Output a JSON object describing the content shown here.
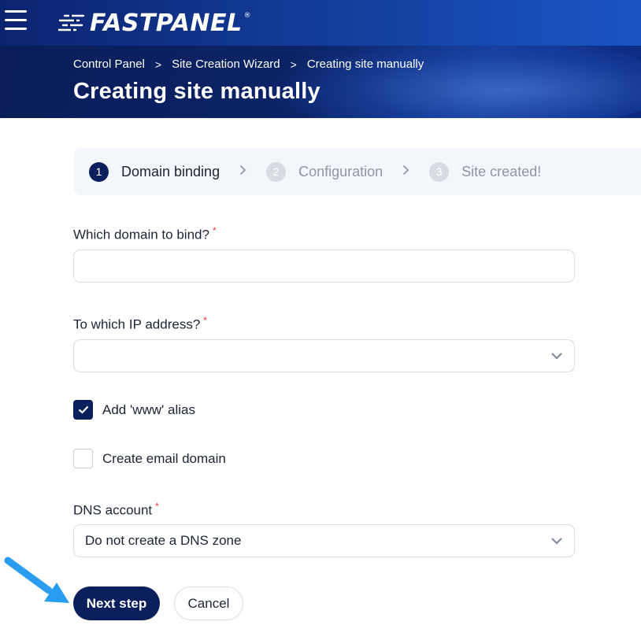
{
  "header": {
    "brand": "FASTPANEL",
    "brand_mark": "®",
    "menu_icon": "hamburger-menu-icon"
  },
  "breadcrumb": {
    "items": [
      "Control Panel",
      "Site Creation Wizard",
      "Creating site manually"
    ],
    "separator": ">"
  },
  "page": {
    "title": "Creating site manually"
  },
  "stepper": {
    "steps": [
      {
        "number": "1",
        "label": "Domain binding",
        "state": "active"
      },
      {
        "number": "2",
        "label": "Configuration",
        "state": "inactive"
      },
      {
        "number": "3",
        "label": "Site created!",
        "state": "inactive"
      }
    ]
  },
  "form": {
    "domain": {
      "label": "Which domain to bind?",
      "required": "*",
      "value": ""
    },
    "ip": {
      "label": "To which IP address?",
      "required": "*",
      "value": ""
    },
    "www_alias": {
      "label": "Add 'www' alias",
      "checked": true
    },
    "email_domain": {
      "label": "Create email domain",
      "checked": false
    },
    "dns": {
      "label": "DNS account",
      "required": "*",
      "value": "Do not create a DNS zone"
    }
  },
  "actions": {
    "next": "Next step",
    "cancel": "Cancel"
  },
  "colors": {
    "accent": "#0b1f5c",
    "required": "#e53935",
    "pointer": "#2a9df0"
  }
}
